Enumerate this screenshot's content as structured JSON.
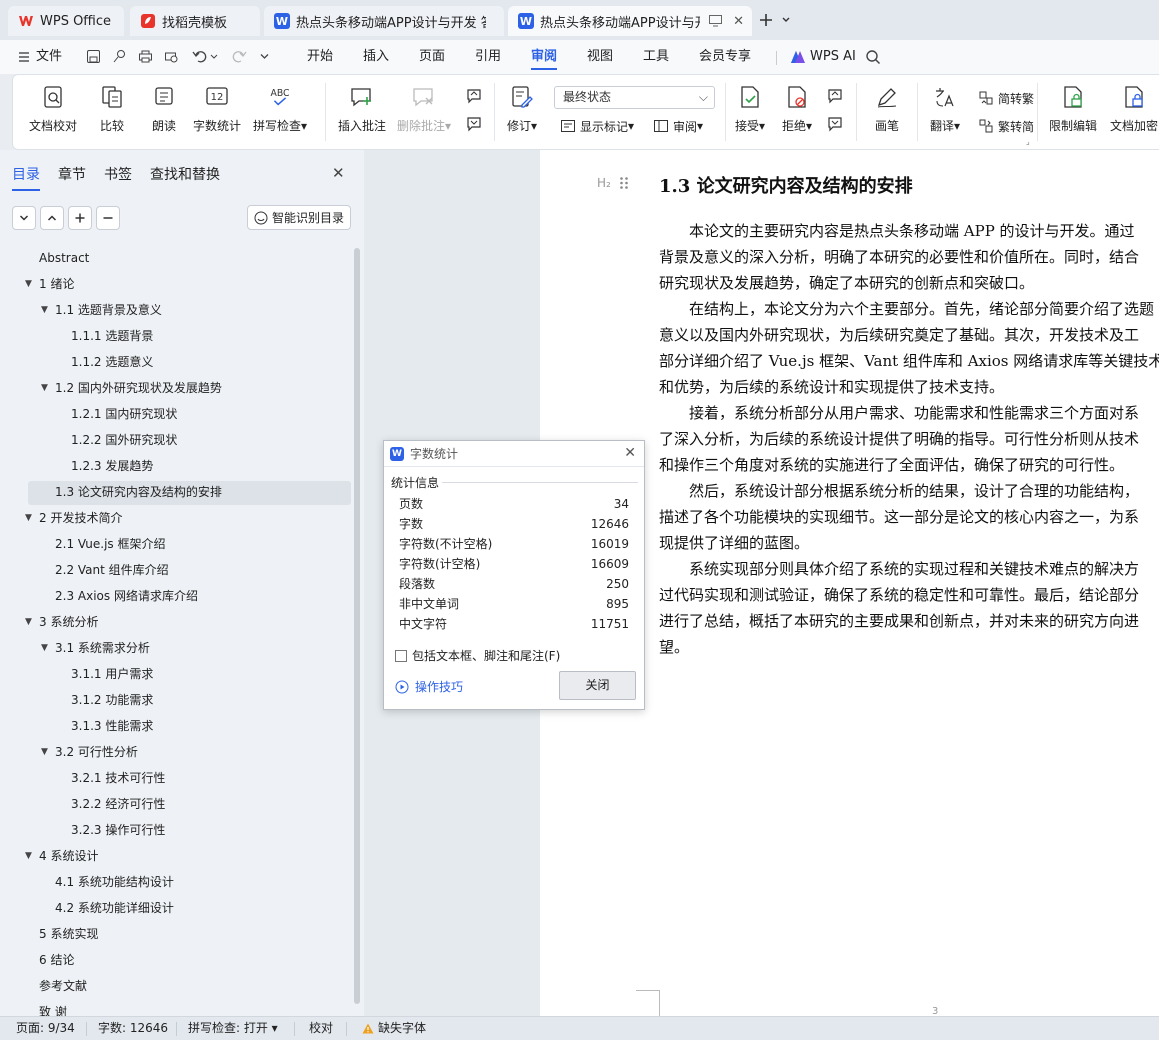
{
  "tabs": [
    {
      "label": "WPS Office",
      "icon": "wps-logo-icon"
    },
    {
      "label": "找稻壳模板",
      "icon": "docer-icon"
    },
    {
      "label": "热点头条移动端APP设计与开发 答辩稿",
      "icon": "word-doc-icon"
    },
    {
      "label": "热点头条移动端APP设计与开发",
      "icon": "word-doc-icon"
    }
  ],
  "menubar": {
    "file": "文件",
    "items": [
      "开始",
      "插入",
      "页面",
      "引用",
      "审阅",
      "视图",
      "工具",
      "会员专享"
    ],
    "active": "审阅",
    "ai": "WPS AI"
  },
  "ribbon": {
    "proofread": "文档校对",
    "compare": "比较",
    "read_aloud": "朗读",
    "word_count": "字数统计",
    "spell_check": "拼写检查",
    "insert_comment": "插入批注",
    "delete_comment": "删除批注",
    "revise": "修订",
    "final_state": "最终状态",
    "show_markup": "显示标记",
    "review": "审阅",
    "accept": "接受",
    "reject": "拒绝",
    "pen": "画笔",
    "translate": "翻译",
    "to_traditional": "简转繁",
    "to_simplified": "繁转简",
    "restrict_edit": "限制编辑",
    "encrypt": "文档加密",
    "abc_icon_text": "ABC",
    "count_icon_text": "12"
  },
  "nav": {
    "tabs": [
      "目录",
      "章节",
      "书签",
      "查找和替换"
    ],
    "smart_btn": "智能识别目录",
    "toc": [
      {
        "t": "Abstract",
        "lvl": 0,
        "car": false
      },
      {
        "t": "1  绪论",
        "lvl": 0,
        "car": true
      },
      {
        "t": "1.1  选题背景及意义",
        "lvl": 1,
        "car": true
      },
      {
        "t": "1.1.1  选题背景",
        "lvl": 2,
        "car": false
      },
      {
        "t": "1.1.2  选题意义",
        "lvl": 2,
        "car": false
      },
      {
        "t": "1.2  国内外研究现状及发展趋势",
        "lvl": 1,
        "car": true
      },
      {
        "t": "1.2.1  国内研究现状",
        "lvl": 2,
        "car": false
      },
      {
        "t": "1.2.2  国外研究现状",
        "lvl": 2,
        "car": false
      },
      {
        "t": "1.2.3  发展趋势",
        "lvl": 2,
        "car": false
      },
      {
        "t": "1.3 论文研究内容及结构的安排",
        "lvl": 1,
        "car": false,
        "sel": true
      },
      {
        "t": "2  开发技术简介",
        "lvl": 0,
        "car": true
      },
      {
        "t": "2.1 Vue.js 框架介绍",
        "lvl": 1,
        "car": false
      },
      {
        "t": "2.2 Vant 组件库介绍",
        "lvl": 1,
        "car": false
      },
      {
        "t": "2.3 Axios 网络请求库介绍",
        "lvl": 1,
        "car": false
      },
      {
        "t": "3  系统分析",
        "lvl": 0,
        "car": true
      },
      {
        "t": "3.1  系统需求分析",
        "lvl": 1,
        "car": true
      },
      {
        "t": "3.1.1  用户需求",
        "lvl": 2,
        "car": false
      },
      {
        "t": "3.1.2  功能需求",
        "lvl": 2,
        "car": false
      },
      {
        "t": "3.1.3  性能需求",
        "lvl": 2,
        "car": false
      },
      {
        "t": "3.2  可行性分析",
        "lvl": 1,
        "car": true
      },
      {
        "t": "3.2.1  技术可行性",
        "lvl": 2,
        "car": false
      },
      {
        "t": "3.2.2  经济可行性",
        "lvl": 2,
        "car": false
      },
      {
        "t": "3.2.3  操作可行性",
        "lvl": 2,
        "car": false
      },
      {
        "t": "4  系统设计",
        "lvl": 0,
        "car": true
      },
      {
        "t": "4.1  系统功能结构设计",
        "lvl": 1,
        "car": false
      },
      {
        "t": "4.2  系统功能详细设计",
        "lvl": 1,
        "car": false
      },
      {
        "t": "5  系统实现",
        "lvl": 0,
        "car": false
      },
      {
        "t": "6  结论",
        "lvl": 0,
        "car": false
      },
      {
        "t": "参考文献",
        "lvl": 0,
        "car": false
      },
      {
        "t": "致    谢",
        "lvl": 0,
        "car": false
      }
    ]
  },
  "doc": {
    "heading_mark": "H₂",
    "heading": "1.3 论文研究内容及结构的安排",
    "lines": [
      "　　本论文的主要研究内容是热点头条移动端 APP 的设计与开发。通过",
      "背景及意义的深入分析，明确了本研究的必要性和价值所在。同时，结合",
      "研究现状及发展趋势，确定了本研究的创新点和突破口。",
      "　　在结构上，本论文分为六个主要部分。首先，绪论部分简要介绍了选题",
      "意义以及国内外研究现状，为后续研究奠定了基础。其次，开发技术及工",
      "部分详细介绍了 Vue.js 框架、Vant 组件库和 Axios 网络请求库等关键技术",
      "和优势，为后续的系统设计和实现提供了技术支持。",
      "　　接着，系统分析部分从用户需求、功能需求和性能需求三个方面对系",
      "了深入分析，为后续的系统设计提供了明确的指导。可行性分析则从技术",
      "和操作三个角度对系统的实施进行了全面评估，确保了研究的可行性。",
      "　　然后，系统设计部分根据系统分析的结果，设计了合理的功能结构，",
      "描述了各个功能模块的实现细节。这一部分是论文的核心内容之一，为系",
      "现提供了详细的蓝图。",
      "　　系统实现部分则具体介绍了系统的实现过程和关键技术难点的解决方",
      "过代码实现和测试验证，确保了系统的稳定性和可靠性。最后，结论部分",
      "进行了总结，概括了本研究的主要成果和创新点，并对未来的研究方向进",
      "望。"
    ],
    "page_number": "3"
  },
  "dialog": {
    "title": "字数统计",
    "section": "统计信息",
    "rows": [
      {
        "label": "页数",
        "value": "34"
      },
      {
        "label": "字数",
        "value": "12646"
      },
      {
        "label": "字符数(不计空格)",
        "value": "16019"
      },
      {
        "label": "字符数(计空格)",
        "value": "16609"
      },
      {
        "label": "段落数",
        "value": "250"
      },
      {
        "label": "非中文单词",
        "value": "895"
      },
      {
        "label": "中文字符",
        "value": "11751"
      }
    ],
    "checkbox": "包括文本框、脚注和尾注(F)",
    "tips": "操作技巧",
    "close": "关闭"
  },
  "status": {
    "page": "页面: 9/34",
    "words": "字数: 12646",
    "spell": "拼写检查: 打开",
    "proof": "校对",
    "missing_font": "缺失字体"
  },
  "colors": {
    "accent": "#2d62e6",
    "wps_red": "#e8342b"
  }
}
